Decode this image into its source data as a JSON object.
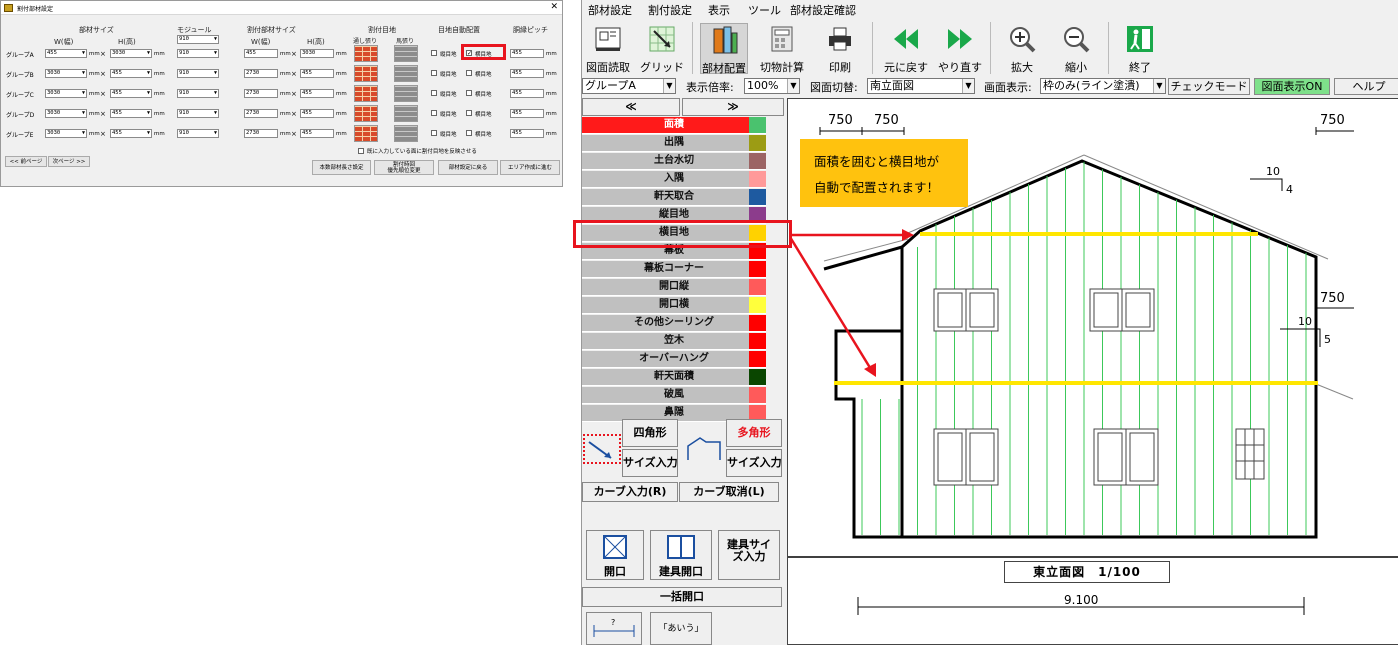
{
  "dialog": {
    "title": "割付部材設定",
    "headers": {
      "buzai_size": "部材サイズ",
      "width": "W(幅)",
      "height": "H(高)",
      "module": "モジュール",
      "waritsuke_size": "割付部材サイズ",
      "width2": "W(幅)",
      "height2": "H(高)",
      "waritsuke_meji": "割付目地",
      "toushi": "通し張り",
      "uma": "馬張り",
      "meji_auto": "目地自動配置",
      "dobuchi": "胴縁ピッチ"
    },
    "unit": "mm",
    "times": "×",
    "tate_label": "縦目地",
    "yoko_label": "横目地",
    "groups": [
      {
        "name": "グループA",
        "w": "455",
        "h": "3030",
        "module": "910",
        "w2": "455",
        "h2": "3030",
        "pitch": "455"
      },
      {
        "name": "グループB",
        "w": "3030",
        "h": "455",
        "module": "910",
        "w2": "2730",
        "h2": "455",
        "pitch": "455"
      },
      {
        "name": "グループC",
        "w": "3030",
        "h": "455",
        "module": "910",
        "w2": "2730",
        "h2": "455",
        "pitch": "455"
      },
      {
        "name": "グループD",
        "w": "3030",
        "h": "455",
        "module": "910",
        "w2": "2730",
        "h2": "455",
        "pitch": "455"
      },
      {
        "name": "グループE",
        "w": "3030",
        "h": "455",
        "module": "910",
        "w2": "2730",
        "h2": "455",
        "pitch": "455"
      }
    ],
    "module_top": "910",
    "reflect_label": "既に入力している面に割付目地を反映させる",
    "prev_page": "<< 前ページ",
    "next_page": "次ページ >>",
    "btn_length": "本数部材長さ設定",
    "btn_order_1": "割付時回",
    "btn_order_2": "優先順位変更",
    "btn_back": "部材設定に戻る",
    "btn_area": "エリア作成に進む",
    "highlight_color": "#e8141e"
  },
  "app": {
    "menu": [
      "部材設定",
      "割付設定",
      "表示",
      "ツール",
      "部材設定確認"
    ],
    "toolbar": [
      {
        "label": "図面読取",
        "icon": "blueprint-icon"
      },
      {
        "label": "グリッド",
        "icon": "grid-icon"
      },
      {
        "label": "部材配置",
        "icon": "materials-icon"
      },
      {
        "label": "切物計算",
        "icon": "calculator-icon"
      },
      {
        "label": "印刷",
        "icon": "printer-icon"
      },
      {
        "label": "元に戻す",
        "icon": "undo-icon"
      },
      {
        "label": "やり直す",
        "icon": "redo-icon"
      },
      {
        "label": "拡大",
        "icon": "zoom-in-icon"
      },
      {
        "label": "縮小",
        "icon": "zoom-out-icon"
      },
      {
        "label": "終了",
        "icon": "exit-icon"
      }
    ],
    "group_select": "グループA",
    "zoom_label": "表示倍率:",
    "zoom_value": "100%",
    "view_label": "図面切替:",
    "view_value": "南立面図",
    "display_label": "画面表示:",
    "display_value": "枠のみ(ライン塗潰)",
    "check_mode": "チェックモード",
    "drawing_on": "図面表示ON",
    "help": "ヘルプ",
    "nav_prev": "≪",
    "nav_next": "≫",
    "list": [
      {
        "label": "面積",
        "color": "#4ac26e",
        "active": true
      },
      {
        "label": "出隅",
        "color": "#9c9c14"
      },
      {
        "label": "土台水切",
        "color": "#9c6464"
      },
      {
        "label": "入隅",
        "color": "#ff9a9a"
      },
      {
        "label": "軒天取合",
        "color": "#1e5aa0"
      },
      {
        "label": "縦目地",
        "color": "#8c3c8c"
      },
      {
        "label": "横目地",
        "color": "#ffd200"
      },
      {
        "label": "幕板",
        "color": "#ff0000"
      },
      {
        "label": "幕板コーナー",
        "color": "#ff0000"
      },
      {
        "label": "開口縦",
        "color": "#ff5a5a"
      },
      {
        "label": "開口横",
        "color": "#ffff3c"
      },
      {
        "label": "その他シーリング",
        "color": "#ff0000"
      },
      {
        "label": "笠木",
        "color": "#ff0000"
      },
      {
        "label": "オーバーハング",
        "color": "#ff0000"
      },
      {
        "label": "軒天面積",
        "color": "#0a4600"
      },
      {
        "label": "破風",
        "color": "#ff5a5a"
      },
      {
        "label": "鼻隠",
        "color": "#ff5a5a"
      }
    ],
    "shape_rect": "四角形",
    "shape_poly": "多角形",
    "size_input": "サイズ入力",
    "curve_input": "カーブ入力(R)",
    "curve_cancel": "カーブ取消(L)",
    "opening": "開口",
    "fitting_opening": "建具開口",
    "fitting_size": "建具サイズ入力",
    "batch_opening": "一括開口",
    "dim_tool": "?",
    "text_tool": "「あいう」"
  },
  "drawing": {
    "dims_top": [
      "750",
      "750",
      "750"
    ],
    "dim_right": "750",
    "slope_top": [
      "10",
      "4"
    ],
    "slope_side": [
      "10",
      "5"
    ],
    "callout_line1": "面積を囲むと横目地が",
    "callout_line2": "自動で配置されます！",
    "title": "東立面図　1/100",
    "width_dim": "9.100"
  }
}
